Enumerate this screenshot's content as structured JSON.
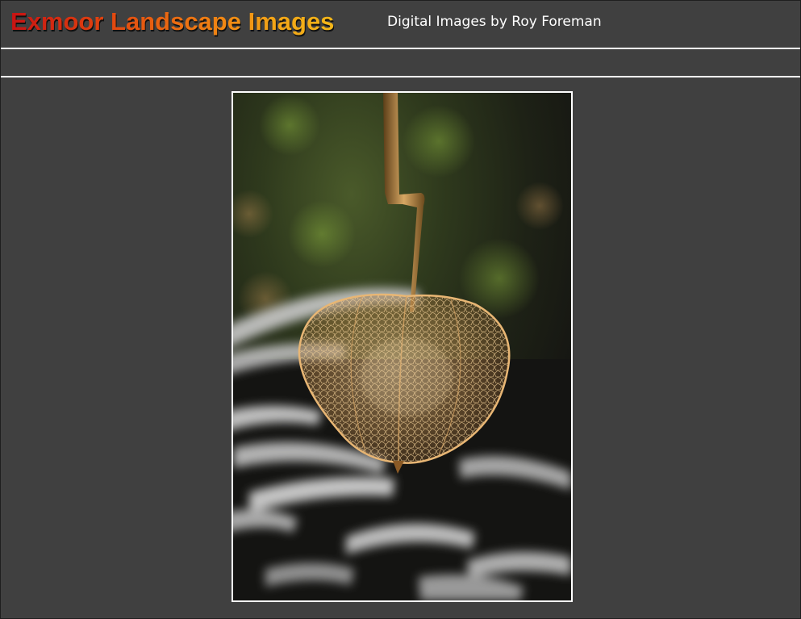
{
  "header": {
    "site_title": "Exmoor Landscape Images",
    "byline": "Digital Images by Roy Foreman"
  },
  "photo": {
    "subject_icon": "lantern-seed-pod-photo"
  },
  "colors": {
    "page_background": "#404040",
    "rule_color": "#ffffff",
    "title_gradient_start": "#c81313",
    "title_gradient_end": "#f3b619",
    "byline_color": "#ffffff"
  }
}
